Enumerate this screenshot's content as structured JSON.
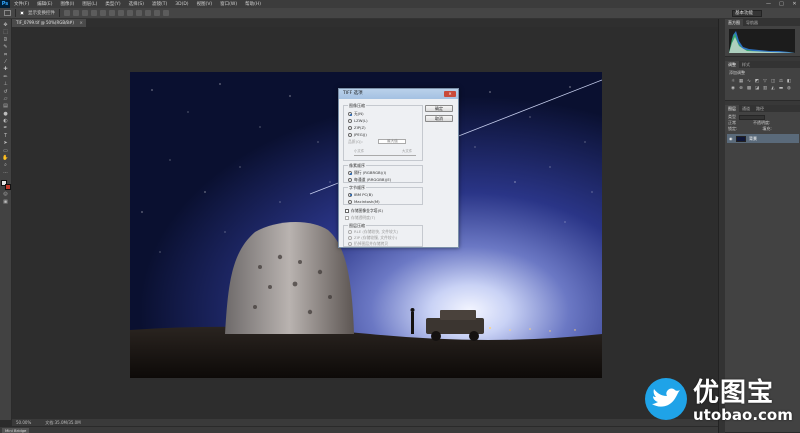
{
  "app": {
    "logo": "Ps"
  },
  "menu": [
    "文件(F)",
    "编辑(E)",
    "图像(I)",
    "图层(L)",
    "类型(Y)",
    "选择(S)",
    "滤镜(T)",
    "3D(D)",
    "视图(V)",
    "窗口(W)",
    "帮助(H)"
  ],
  "window_controls": {
    "min": "—",
    "max": "□",
    "close": "✕"
  },
  "options_bar": {
    "label": "显示变换控件",
    "workspace": "基本功能"
  },
  "document": {
    "tab_label": "TIF_0799.tif @ 50%(RGB/8#)",
    "tab_close": "×"
  },
  "status": {
    "zoom": "50.00%",
    "doc_size": "文档:35.0M/35.0M"
  },
  "mini_bridge": "Mini Bridge",
  "panels": {
    "histogram_tabs": [
      "直方图",
      "导航器"
    ],
    "adjust_tabs": [
      "调整",
      "样式"
    ],
    "adjust_label": "添加调整",
    "layer_tabs": [
      "图层",
      "通道",
      "路径"
    ],
    "layer_kind": "类型",
    "layer_blend": "正常",
    "layer_opacity_label": "不透明度:",
    "layer_lock_label": "锁定:",
    "layer_fill_label": "填充:",
    "layer_name": "背景"
  },
  "dialog": {
    "title": "TIFF 选项",
    "close": "✕",
    "ok": "确定",
    "cancel": "取消",
    "image_compression": {
      "title": "图像压缩",
      "options": [
        "无(N)",
        "LZW(L)",
        "ZIP(Z)",
        "JPEG(J)"
      ],
      "quality_label": "品质(Q):",
      "quality_value": "最大值",
      "small_file": "小文件",
      "large_file": "大文件"
    },
    "pixel_order": {
      "title": "像素顺序",
      "options": [
        "隔行 (RGBRGB)(I)",
        "每通道 (RRGGBB)(E)"
      ]
    },
    "byte_order": {
      "title": "字节顺序",
      "options": [
        "IBM PC(B)",
        "Macintosh(M)"
      ]
    },
    "save_pyramid": "存储图像金字塔(S)",
    "save_transparency": "存储透明度(T)",
    "layer_compression": {
      "title": "图层压缩",
      "options": [
        "RLE (存储较快, 文件较大)",
        "ZIP (存储较慢, 文件较小)",
        "扔掉图层并存储拷贝"
      ]
    }
  },
  "watermark": {
    "title": "优图宝",
    "url": "utobao.com"
  },
  "colors": {
    "fg": "#e4e4e4",
    "bg": "#c0392b",
    "brand_blue": "#1fa3e8"
  }
}
